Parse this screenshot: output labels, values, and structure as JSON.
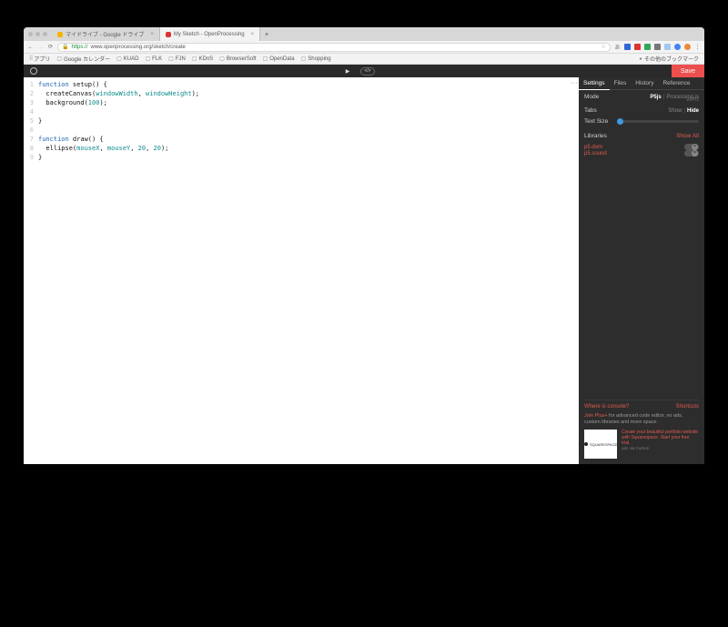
{
  "browser": {
    "tabs": [
      {
        "title": "マイドライブ - Google ドライブ",
        "favicon": "#f4b400"
      },
      {
        "title": "My Sketch - OpenProcessing",
        "favicon": "#d33"
      }
    ],
    "active_tab": 1,
    "url_secure": "https://",
    "url_rest": "www.openprocessing.org/sketch/create",
    "bookmarks_label": "アプリ",
    "bookmarks": [
      "Google カレンダー",
      "KUAD",
      "FLK",
      "FJN",
      "KDnS",
      "BrowserSoft",
      "OpenData",
      "Shopping"
    ],
    "other_bookmarks": "その他のブックマーク"
  },
  "toolbar": {
    "save_label": "Save"
  },
  "code": {
    "lines": [
      [
        {
          "t": "function",
          "c": "kw"
        },
        {
          "t": " setup() {",
          "c": "fn"
        }
      ],
      [
        {
          "t": "  createCanvas(",
          "c": "fn"
        },
        {
          "t": "windowWidth",
          "c": "var"
        },
        {
          "t": ", ",
          "c": "fn"
        },
        {
          "t": "windowHeight",
          "c": "var"
        },
        {
          "t": ");",
          "c": "fn"
        }
      ],
      [
        {
          "t": "  background(",
          "c": "fn"
        },
        {
          "t": "100",
          "c": "num"
        },
        {
          "t": ");",
          "c": "fn"
        }
      ],
      [
        {
          "t": "",
          "c": "fn"
        }
      ],
      [
        {
          "t": "}",
          "c": "fn"
        }
      ],
      [
        {
          "t": "",
          "c": "fn"
        }
      ],
      [
        {
          "t": "function",
          "c": "kw"
        },
        {
          "t": " draw() {",
          "c": "fn"
        }
      ],
      [
        {
          "t": "  ellipse(",
          "c": "fn"
        },
        {
          "t": "mouseX",
          "c": "var"
        },
        {
          "t": ", ",
          "c": "fn"
        },
        {
          "t": "mouseY",
          "c": "var"
        },
        {
          "t": ", ",
          "c": "fn"
        },
        {
          "t": "20",
          "c": "num"
        },
        {
          "t": ", ",
          "c": "fn"
        },
        {
          "t": "20",
          "c": "num"
        },
        {
          "t": ");",
          "c": "fn"
        }
      ],
      [
        {
          "t": "}",
          "c": "fn"
        }
      ]
    ]
  },
  "sidebar": {
    "tabs": [
      "Settings",
      "Files",
      "History",
      "Reference"
    ],
    "active": 0,
    "mode_label": "Mode",
    "mode_selected": "P5js",
    "mode_other": "Processing.js",
    "mode_version": "v0.7.2",
    "tabs_label": "Tabs",
    "tabs_show": "Show",
    "tabs_hide": "Hide",
    "textsize_label": "Text Size",
    "libraries_label": "Libraries",
    "showall_label": "Show All",
    "libs": [
      "p5.dom",
      "p5.sound"
    ],
    "console_label": "Where is console?",
    "shortcuts_label": "Shortcuts",
    "promo_plus": "Join Plus+",
    "promo_rest": " for advanced code editor, no ads, custom libraries and more space.",
    "ad_brand": "SQUARESPACE",
    "ad_text": "Create your beautiful portfolio website with Squarespace. Start your free trial.",
    "ad_via": "ads via Carbon"
  }
}
